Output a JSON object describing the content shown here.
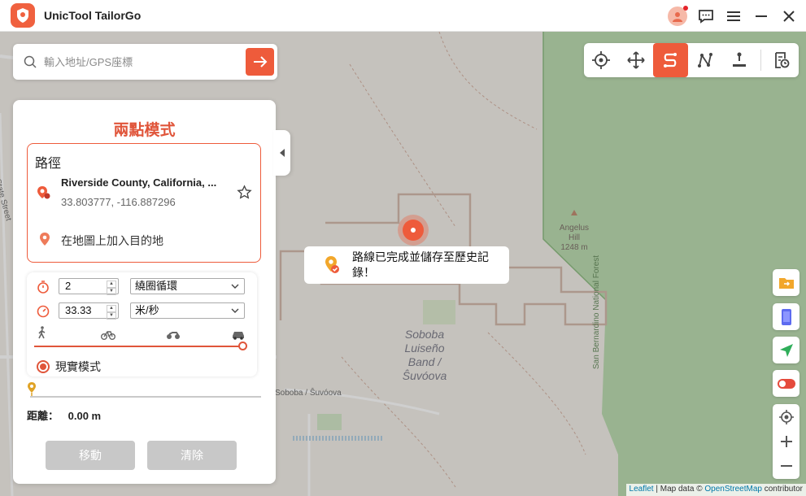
{
  "app": {
    "title": "UnicTool TailorGo"
  },
  "search": {
    "placeholder": "輸入地址/GPS座標"
  },
  "map": {
    "area_label": "Soboba Luiseño Band / Ŝuvóova",
    "area_label_lines": [
      "Soboba",
      "Luiseño",
      "Band /",
      "Ŝuvóova"
    ],
    "peak_name": "Angelus Hill",
    "peak_name_lines": [
      "Angelus",
      "Hill"
    ],
    "peak_elevation": "1248 m",
    "road_label": "Soboba / Ŝuvóova",
    "forest_label": "San Bernardino National Forest",
    "street_label": "State Street"
  },
  "panel": {
    "title": "兩點模式",
    "route_label": "路徑",
    "start": {
      "name": "Riverside County, California, ...",
      "coords": "33.803777, -116.887296"
    },
    "destination_placeholder": "在地圖上加入目的地",
    "repeat_count": "2",
    "loop_mode": "繞圈循環",
    "speed": "33.33",
    "speed_unit": "米/秒",
    "speed_fraction": 1.0,
    "realistic_mode": "現實模式",
    "distance_label": "距離：",
    "distance_value": "0.00 m",
    "move_button": "移動",
    "clear_button": "清除"
  },
  "toast": {
    "message": "路線已完成並儲存至歷史記錄！"
  },
  "attribution": {
    "leaflet": "Leaflet",
    "sep": " | Map data © ",
    "osm": "OpenStreetMap",
    "suffix": " contributor"
  },
  "colors": {
    "accent": "#ee5b3b",
    "forest": "#a9d29a",
    "map_bg": "#efebe3"
  }
}
